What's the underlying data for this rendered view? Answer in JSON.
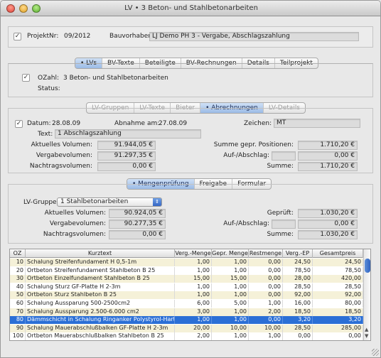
{
  "window": {
    "title": "LV • 3 Beton- und Stahlbetonarbeiten"
  },
  "project": {
    "nr_label": "ProjektNr:",
    "nr_value": "09/2012",
    "bauvorhaben_label": "Bauvorhaben:",
    "bauvorhaben_value": "LJ Demo PH 3 - Vergabe, Abschlagszahlung"
  },
  "tabs_top": [
    "• LVs",
    "BV-Texte",
    "Beteiligte",
    "BV-Rechnungen",
    "Details",
    "Teilprojekt"
  ],
  "lv": {
    "ozahl_label": "OZahl:",
    "ozahl_value": "3  Beton- und Stahlbetonarbeiten",
    "status_label": "Status:"
  },
  "tabs_mid": [
    "LV-Gruppen",
    "LV-Texte",
    "Bieter",
    "• Abrechnungen",
    "LV-Details"
  ],
  "abrechnung": {
    "datum_label": "Datum:",
    "datum_value": "28.08.09",
    "abnahme_label": "Abnahme am:",
    "abnahme_value": "27.08.09",
    "zeichen_label": "Zeichen:",
    "zeichen_value": "MT",
    "text_label": "Text:",
    "text_value": "1 Abschlagszahlung",
    "akt_label": "Aktuelles Volumen:",
    "akt_value": "91.944,05 €",
    "verg_label": "Vergabevolumen:",
    "verg_value": "91.297,35 €",
    "nach_label": "Nachtragsvolumen:",
    "nach_value": "0,00 €",
    "summe_gepr_label": "Summe gepr. Positionen:",
    "summe_gepr_value": "1.710,20 €",
    "aufab_label": "Auf-/Abschlag:",
    "aufab_value": "0,00 €",
    "summe_label": "Summe:",
    "summe_value": "1.710,20 €"
  },
  "tabs_bottom": [
    "• Mengenprüfung",
    "Freigabe",
    "Formular"
  ],
  "mengen": {
    "gruppe_label": "LV-Gruppe:",
    "gruppe_value": "1 Stahlbetonarbeiten",
    "akt_label": "Aktuelles Volumen:",
    "akt_value": "90.924,05 €",
    "verg_label": "Vergabevolumen:",
    "verg_value": "90.277,35 €",
    "nach_label": "Nachtragsvolumen:",
    "nach_value": "0,00 €",
    "gepr_label": "Geprüft:",
    "gepr_value": "1.030,20 €",
    "aufab_label": "Auf-/Abschlag:",
    "aufab_value": "0,00 €",
    "summe_label": "Summe:",
    "summe_value": "1.030,20 €"
  },
  "table": {
    "headers": [
      "OZ",
      "Kurztext",
      "Verg.-Menge",
      "Gepr. Menge",
      "Restmenge",
      "Verg.-EP",
      "Gesamtpreis"
    ],
    "rows": [
      [
        "10",
        "Schalung Streifenfundament H 0,5-1m",
        "1,00",
        "1,00",
        "0,00",
        "24,50",
        "24,50"
      ],
      [
        "20",
        "Ortbeton Streifenfundament Stahlbeton B 25",
        "1,00",
        "1,00",
        "0,00",
        "78,50",
        "78,50"
      ],
      [
        "30",
        "Ortbeton Einzelfundament Stahlbeton B 25",
        "15,00",
        "15,00",
        "0,00",
        "28,00",
        "420,00"
      ],
      [
        "40",
        "Schalung Sturz GF-Platte H 2-3m",
        "1,00",
        "1,00",
        "0,00",
        "28,50",
        "28,50"
      ],
      [
        "50",
        "Ortbeton Sturz Stahlbeton B 25",
        "1,00",
        "1,00",
        "0,00",
        "92,00",
        "92,00"
      ],
      [
        "60",
        "Schalung Aussparung 500-2500cm2",
        "6,00",
        "5,00",
        "1,00",
        "16,00",
        "80,00"
      ],
      [
        "70",
        "Schalung Aussparung 2.500-6.000 cm2",
        "3,00",
        "1,00",
        "2,00",
        "18,50",
        "18,50"
      ],
      [
        "80",
        "Dämmschicht in Schalung Ringanker Polystyrol-Hartsc",
        "1,00",
        "1,00",
        "0,00",
        "3,20",
        "3,20"
      ],
      [
        "90",
        "Schalung Mauerabschlußbalken  GF-Platte H 2-3m",
        "20,00",
        "10,00",
        "10,00",
        "28,50",
        "285,00"
      ],
      [
        "100",
        "Ortbeton Mauerabschlußbalken Stahlbeton B 25",
        "2,00",
        "1,00",
        "1,00",
        "0,00",
        "0,00"
      ]
    ],
    "selected_index": 7
  },
  "check_mark": "✓"
}
